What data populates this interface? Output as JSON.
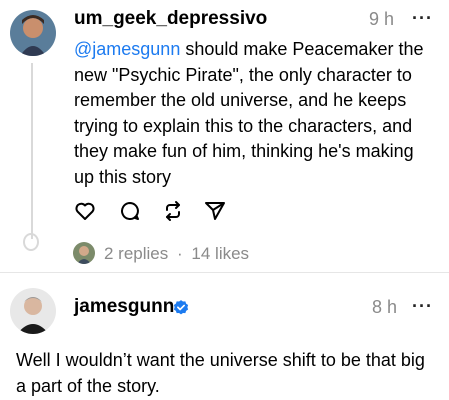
{
  "post1": {
    "username": "um_geek_depressivo",
    "time": "9 h",
    "more": "···",
    "mention": "@jamesgunn",
    "text": " should make Peacemaker the new \"Psychic Pirate\", the only character to remember the old universe, and he keeps trying to explain this to the characters, and they make fun of him, thinking he's making up this story",
    "replies": "2 replies",
    "separator": "·",
    "likes": "14 likes",
    "actions": [
      "heart-icon",
      "comment-icon",
      "repost-icon",
      "share-icon"
    ]
  },
  "post2": {
    "username": "jamesgunn",
    "verified": true,
    "time": "8 h",
    "more": "···",
    "text": "Well I wouldn’t want the universe shift to be that big a part of the story."
  },
  "colors": {
    "mention": "#1d7bf0",
    "verified": "#1d7bf0",
    "meta": "#8a8a8a"
  }
}
